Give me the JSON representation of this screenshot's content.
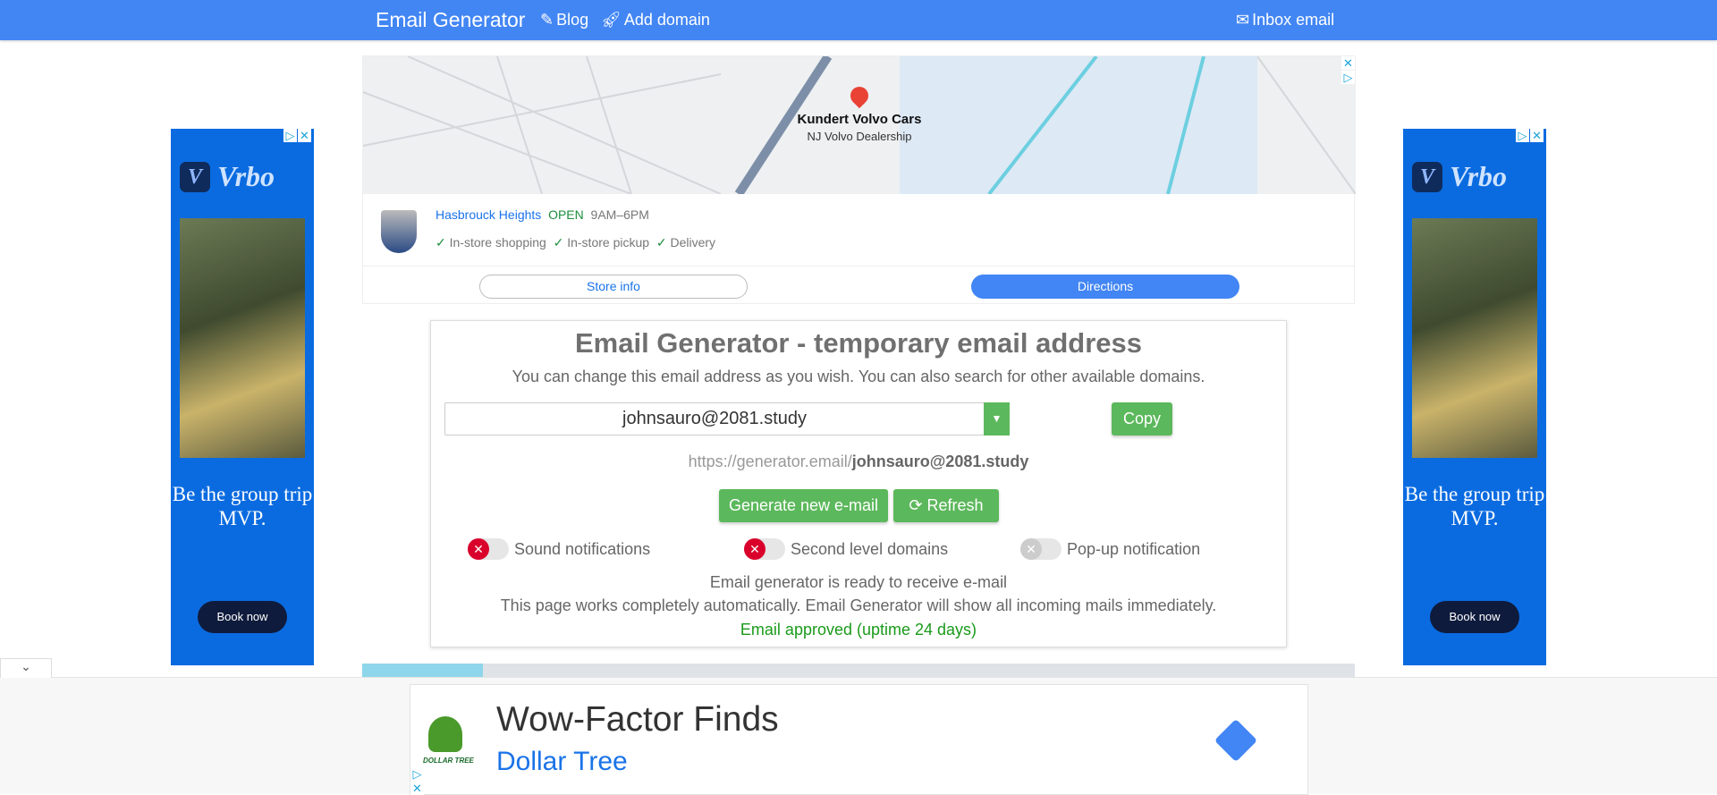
{
  "header": {
    "brand": "Email Generator",
    "nav": [
      {
        "label": "Blog",
        "icon": "pen-icon"
      },
      {
        "label": "Add domain",
        "icon": "rocket-icon"
      }
    ],
    "inbox": "Inbox email",
    "color": "#4286f4"
  },
  "top_ad": {
    "place": "Kundert Volvo Cars",
    "place_sub": "NJ Volvo Dealership",
    "location": "Hasbrouck Heights",
    "status": "OPEN",
    "hours": "9AM–6PM",
    "features": [
      "In-store shopping",
      "In-store pickup",
      "Delivery"
    ],
    "store_info": "Store info",
    "directions": "Directions"
  },
  "side_ad": {
    "brand": "Vrbo",
    "tagline": "Be the group trip MVP.",
    "cta": "Book now"
  },
  "main": {
    "title": "Email Generator - temporary email address",
    "subtitle": "You can change this email address as you wish. You can also search for other available domains.",
    "email": "johnsauro@2081.study",
    "copy": "Copy",
    "url_prefix": "https://generator.email/",
    "url_email": "johnsauro@2081.study",
    "generate": "Generate new e-mail",
    "refresh": "Refresh",
    "toggles": [
      {
        "label": "Sound notifications",
        "on": false
      },
      {
        "label": "Second level domains",
        "on": false
      },
      {
        "label": "Pop-up notification",
        "on": false
      }
    ],
    "status1": "Email generator is ready to receive e-mail",
    "status2": "This page works completely automatically. Email Generator will show all incoming mails immediately.",
    "approved": "Email approved (uptime 24 days)",
    "green": "#5cb85c"
  },
  "bottom_ad": {
    "headline": "Wow-Factor Finds",
    "advertiser": "Dollar Tree",
    "logo_text": "DOLLAR TREE"
  }
}
